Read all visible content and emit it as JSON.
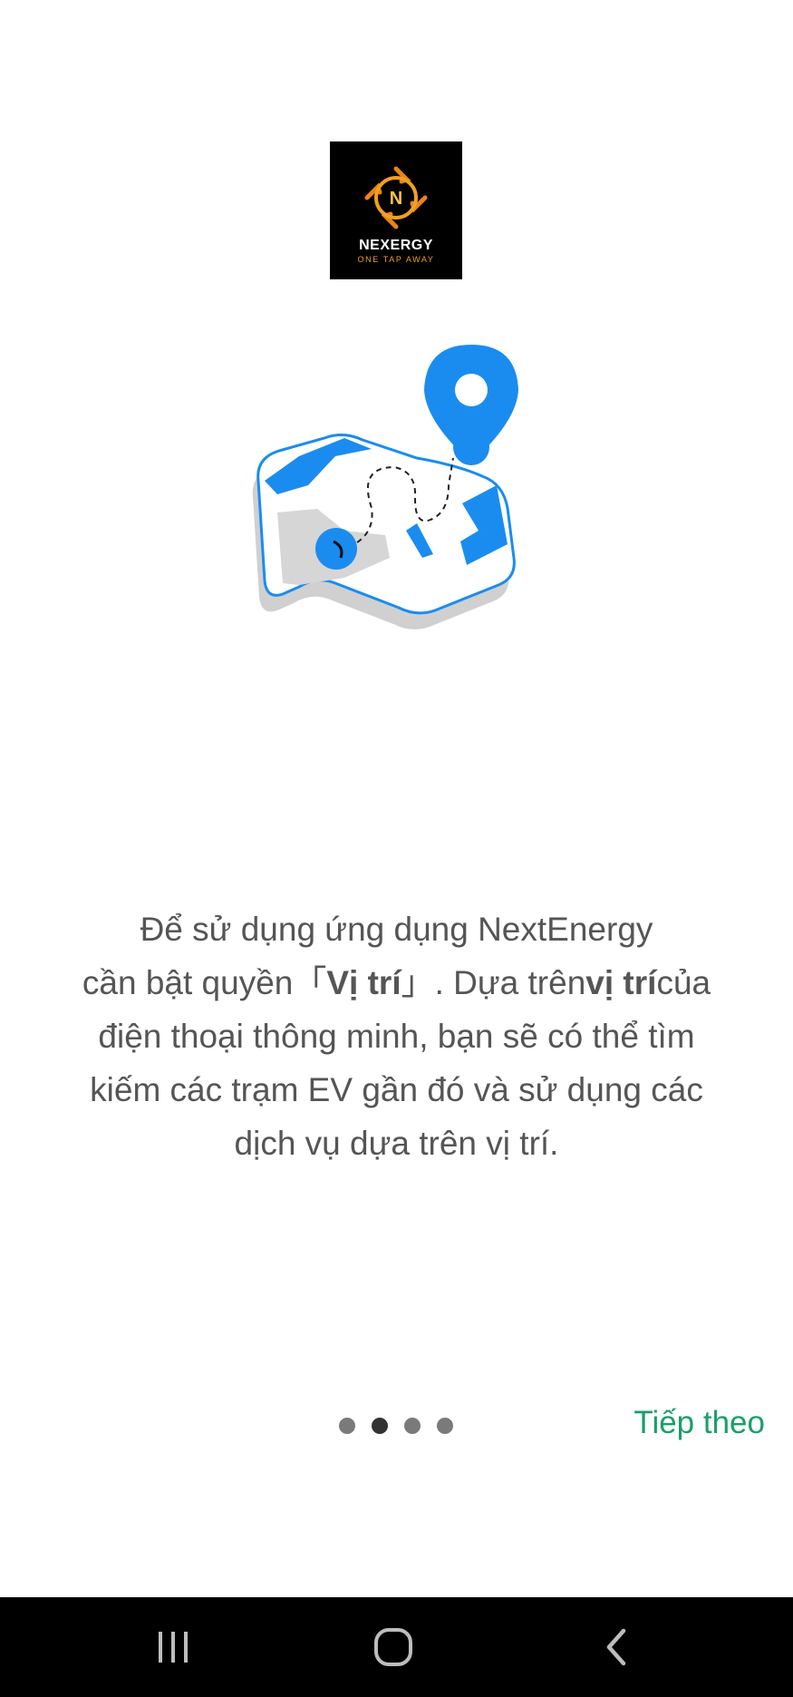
{
  "logo": {
    "brand": "NEXERGY",
    "tagline": "ONE TAP AWAY",
    "letter": "N"
  },
  "message": {
    "line1": "Để sử dụng ứng dụng NextEnergy",
    "line2_pre": "cần bật quyền「",
    "line2_bold1": "Vị trí",
    "line2_mid": "」. Dựa trên",
    "line2_bold2": "vị trí",
    "line2_post": "của",
    "line3": "điện thoại thông minh, bạn sẽ có thể tìm",
    "line4": "kiếm các trạm EV gần đó và sử dụng các",
    "line5": "dịch vụ dựa trên vị trí."
  },
  "pager": {
    "total": 4,
    "active_index": 1
  },
  "next_label": "Tiếp theo",
  "colors": {
    "accent_green": "#1b9e6a",
    "map_blue": "#1a8cf0",
    "text_gray": "#555555"
  },
  "icons": {
    "nav_recents": "recents-icon",
    "nav_home": "home-icon",
    "nav_back": "back-icon",
    "illustration": "map-location-icon"
  }
}
